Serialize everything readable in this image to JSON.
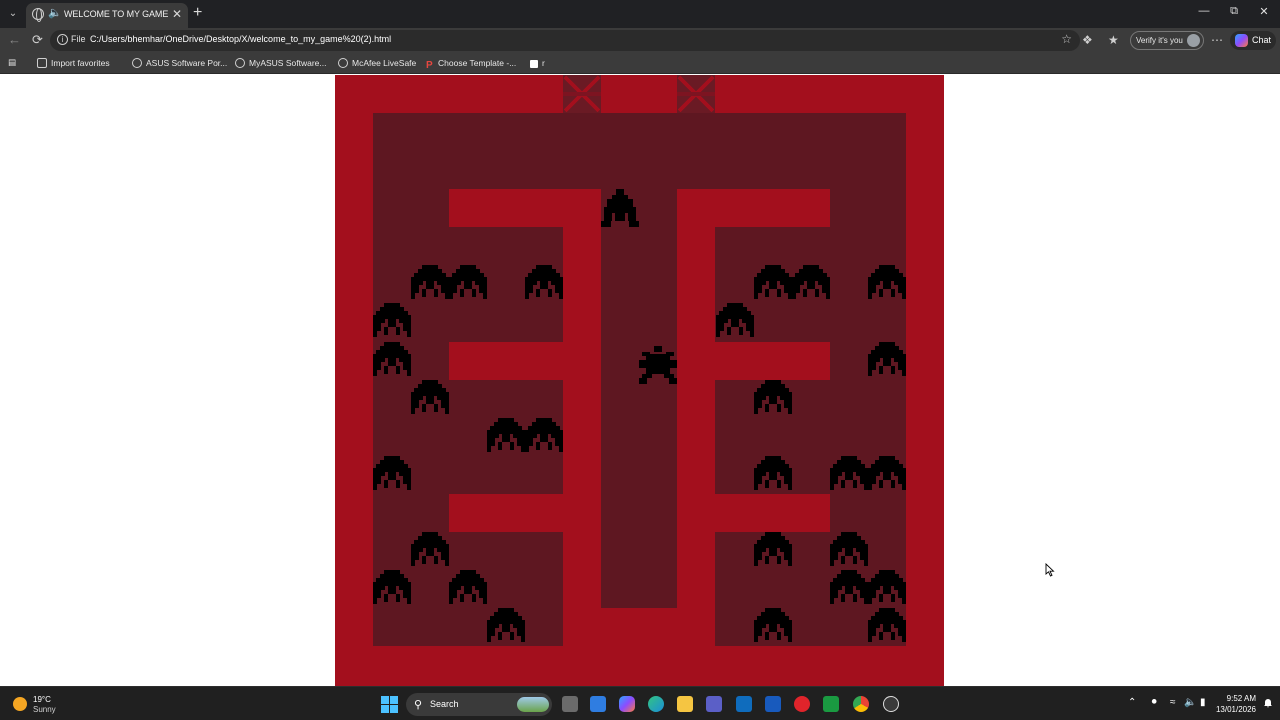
{
  "browser": {
    "tab_title": "WELCOME TO MY GAME",
    "address_scheme": "File",
    "url": "C:/Users/bhemhar/OneDrive/Desktop/X/welcome_to_my_game%20(2).html",
    "verify_label": "Verify it's you",
    "chat_label": "Chat"
  },
  "favorites": [
    {
      "label": "Import favorites",
      "icon": "import-icon"
    },
    {
      "label": "ASUS Software Por...",
      "icon": "globe-icon"
    },
    {
      "label": "MyASUS Software...",
      "icon": "globe-icon"
    },
    {
      "label": "McAfee LiveSafe",
      "icon": "globe-icon"
    },
    {
      "label": "Choose Template -...",
      "icon": "p-icon"
    },
    {
      "label": "r",
      "icon": "square-icon"
    }
  ],
  "game": {
    "colors": {
      "wall": "#a30f1d",
      "floor": "#5e1721",
      "sprite": "#000000",
      "gate": "#6a1a24"
    }
  },
  "taskbar": {
    "weather_temp": "19°C",
    "weather_condition": "Sunny",
    "search_label": "Search",
    "time": "9:52 AM",
    "date": "13/01/2026"
  }
}
